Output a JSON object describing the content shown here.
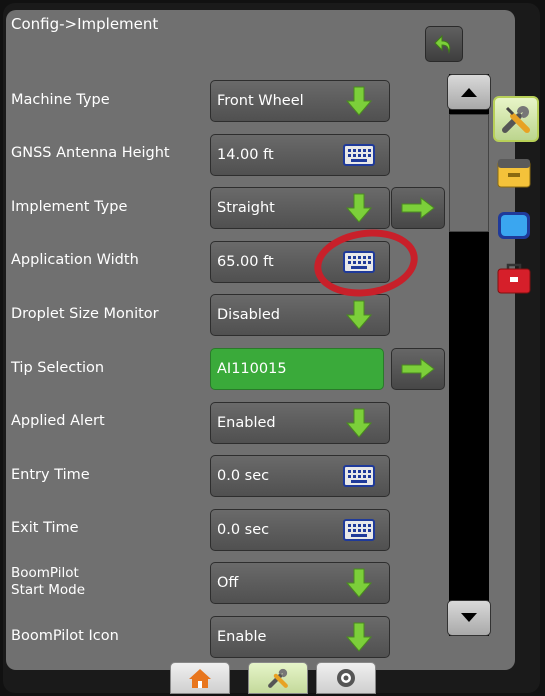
{
  "header": {
    "title": "Config->Implement",
    "back_icon": "back-arrow-icon"
  },
  "rows": [
    {
      "label": "Machine Type",
      "value": "Front Wheel",
      "control": "dropdown"
    },
    {
      "label": "GNSS Antenna Height",
      "value": "14.00 ft",
      "control": "keyboard"
    },
    {
      "label": "Implement Type",
      "value": "Straight",
      "control": "dropdown",
      "next": true
    },
    {
      "label": "Application Width",
      "value": "65.00 ft",
      "control": "keyboard",
      "highlighted": true
    },
    {
      "label": "Droplet Size Monitor",
      "value": "Disabled",
      "control": "dropdown"
    },
    {
      "label": "Tip Selection",
      "value": "AI110015",
      "control": "next"
    },
    {
      "label": "Applied Alert",
      "value": "Enabled",
      "control": "dropdown"
    },
    {
      "label": "Entry Time",
      "value": "0.0 sec",
      "control": "keyboard"
    },
    {
      "label": "Exit Time",
      "value": "0.0 sec",
      "control": "keyboard"
    },
    {
      "label": "BoomPilot Start Mode",
      "value": "Off",
      "control": "dropdown"
    },
    {
      "label": "BoomPilot Icon",
      "value": "Enable",
      "control": "dropdown"
    }
  ],
  "scrollbar": {
    "up_icon": "scroll-up-icon",
    "down_icon": "scroll-down-icon"
  },
  "side_tabs": [
    "tools-icon",
    "console-icon",
    "screen-icon",
    "toolbox-icon"
  ],
  "bottom_tabs": [
    "home-icon",
    "tools-icon",
    "target-icon"
  ],
  "colors": {
    "panel": "#707070",
    "green_field": "#3aaa3a",
    "arrow_green": "#7ccf3a",
    "highlight": "#c8202a"
  }
}
